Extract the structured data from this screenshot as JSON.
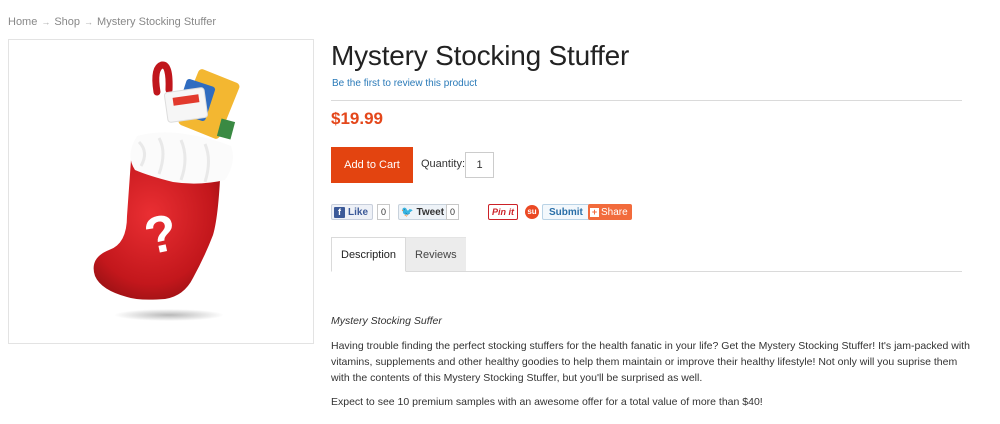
{
  "breadcrumb": {
    "home": "Home",
    "shop": "Shop",
    "current": "Mystery Stocking Stuffer",
    "separator": "→"
  },
  "product": {
    "title": "Mystery Stocking Stuffer",
    "review_link": "Be the first to review this product",
    "price": "$19.99",
    "image_icon": "red-christmas-stocking-with-question-mark"
  },
  "cart": {
    "add_label": "Add to Cart",
    "quantity_label": "Quantity:",
    "quantity_value": "1"
  },
  "social": {
    "facebook_label": "Like",
    "facebook_count": "0",
    "twitter_label": "Tweet",
    "twitter_count": "0",
    "pinterest_label": "Pin it",
    "stumbleupon_label": "Submit",
    "share_label": "Share"
  },
  "tabs": [
    {
      "label": "Description"
    },
    {
      "label": "Reviews"
    }
  ],
  "description": {
    "heading": "Mystery Stocking Suffer",
    "paragraph1": "Having trouble finding the perfect stocking stuffers for the health fanatic in your life? Get the Mystery Stocking Stuffer! It's jam-packed with vitamins, supplements and other healthy goodies to help them maintain or improve their healthy lifestyle! Not only will you suprise them with the contents of this Mystery Stocking Stuffer, but you'll be surprised as well.",
    "paragraph2": "Expect to see 10 premium samples with an awesome offer for a total value of more than $40!"
  },
  "colors": {
    "price": "#e4471b",
    "add_to_cart": "#e34410",
    "link": "#2a7ab8",
    "stocking_red": "#d41c22"
  }
}
